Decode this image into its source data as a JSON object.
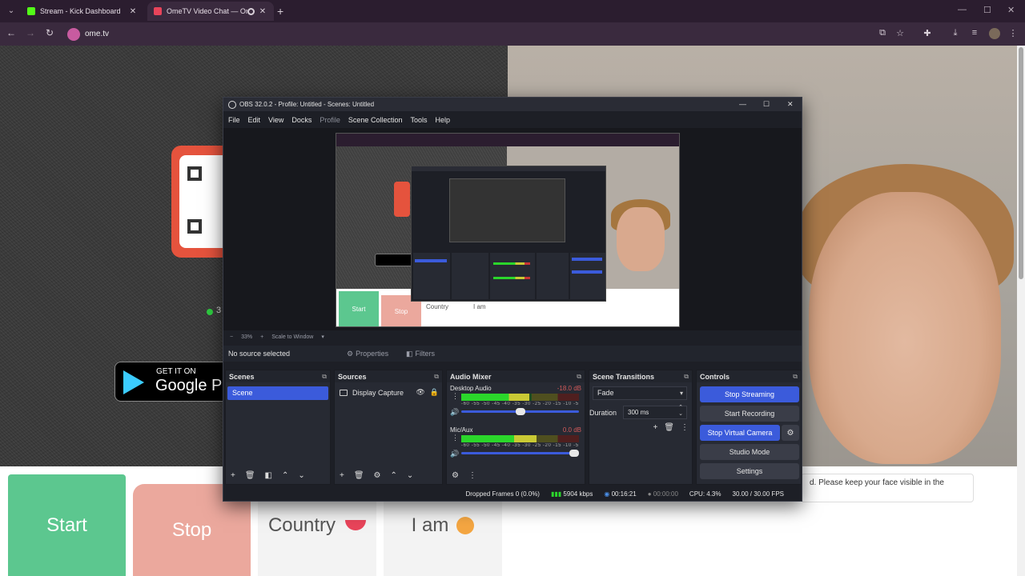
{
  "browser": {
    "tabs": [
      {
        "title": "Stream - Kick Dashboard",
        "favicon_color": "#53fc18"
      },
      {
        "title": "OmeTV Video Chat — Ome",
        "favicon_color": "#e8445a"
      }
    ],
    "url": "ome.tv"
  },
  "site": {
    "online_count": "3",
    "google_play": {
      "small": "GET IT ON",
      "big": "Google P"
    },
    "buttons": {
      "start": "Start",
      "stop": "Stop",
      "country": "Country",
      "iam": "I am"
    },
    "message": "d. Please keep your face visible in the"
  },
  "obs": {
    "title": "OBS 32.0.2 - Profile: Untitled - Scenes: Untitled",
    "menu": [
      "File",
      "Edit",
      "View",
      "Docks",
      "Profile",
      "Scene Collection",
      "Tools",
      "Help"
    ],
    "preview_status": {
      "zoom": "33%",
      "scale": "Scale to Window"
    },
    "preview": {
      "start": "Start",
      "stop": "Stop",
      "country": "Country",
      "iam": "I am"
    },
    "no_source": "No source selected",
    "properties_label": "Properties",
    "filters_label": "Filters",
    "docks": {
      "scenes": {
        "title": "Scenes",
        "items": [
          "Scene"
        ]
      },
      "sources": {
        "title": "Sources",
        "items": [
          "Display Capture"
        ]
      },
      "mixer": {
        "title": "Audio Mixer",
        "channels": [
          {
            "name": "Desktop Audio",
            "db": "-18.0 dB",
            "level": 0.58,
            "volume": 0.5
          },
          {
            "name": "Mic/Aux",
            "db": "0.0 dB",
            "level": 0.64,
            "volume": 1.0
          }
        ],
        "scale": "-60 -55 -50 -45 -40 -35 -30 -25 -20 -15 -10 -5 0"
      },
      "transitions": {
        "title": "Scene Transitions",
        "selected": "Fade",
        "duration_label": "Duration",
        "duration": "300 ms"
      },
      "controls": {
        "title": "Controls",
        "buttons": [
          "Stop Streaming",
          "Start Recording",
          "Stop Virtual Camera",
          "Studio Mode",
          "Settings"
        ]
      }
    },
    "status": {
      "dropped": "Dropped Frames 0 (0.0%)",
      "kbps": "5904 kbps",
      "stream_time": "00:16:21",
      "rec_time": "00:00:00",
      "cpu": "CPU: 4.3%",
      "fps": "30.00 / 30.00 FPS"
    },
    "accent_color": "#3b5bdb"
  }
}
